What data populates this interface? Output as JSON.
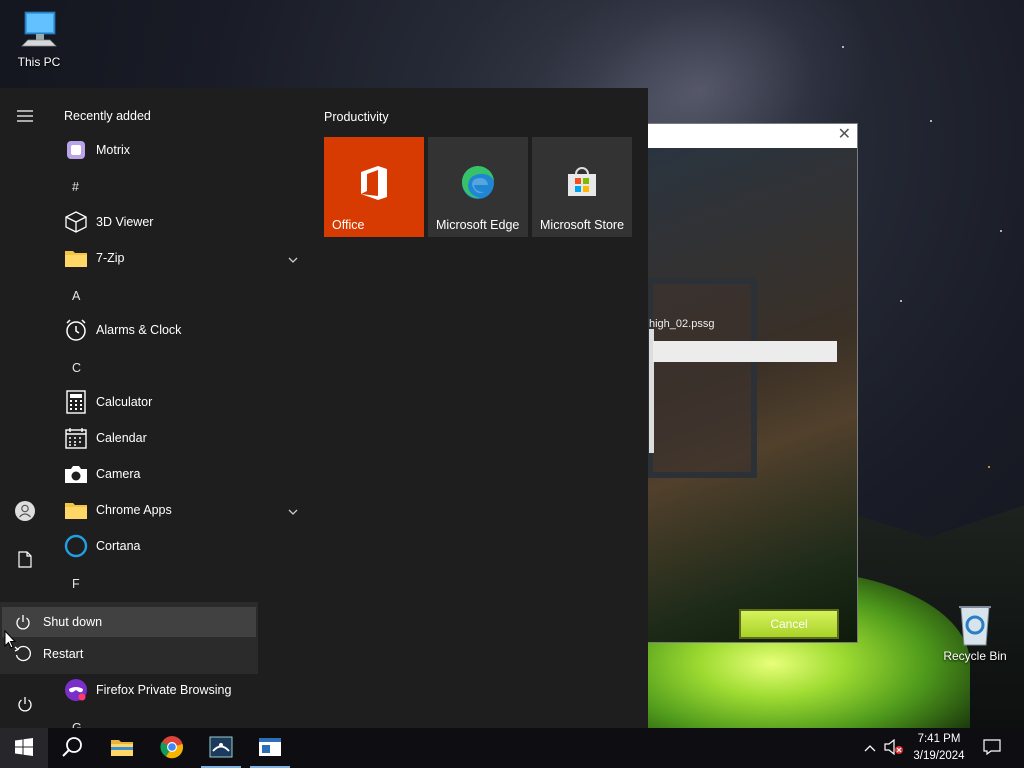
{
  "desktop": {
    "icons": [
      {
        "label": "This PC",
        "icon": "computer-icon"
      },
      {
        "label": "Recycle Bin",
        "icon": "recycle-bin-icon"
      }
    ]
  },
  "dialog": {
    "filename": "high_02.pssg",
    "cancel_label": "Cancel",
    "close_glyph": "✕",
    "progress": 0
  },
  "start_menu": {
    "recently_added_title": "Recently added",
    "apps": [
      {
        "label": "Motrix",
        "icon": "motrix-icon"
      },
      {
        "letter": "#"
      },
      {
        "label": "3D Viewer",
        "icon": "cube-icon"
      },
      {
        "label": "7-Zip",
        "icon": "folder-icon",
        "expandable": true
      },
      {
        "letter": "A"
      },
      {
        "label": "Alarms & Clock",
        "icon": "alarm-clock-icon"
      },
      {
        "letter": "C"
      },
      {
        "label": "Calculator",
        "icon": "calculator-icon"
      },
      {
        "label": "Calendar",
        "icon": "calendar-icon"
      },
      {
        "label": "Camera",
        "icon": "camera-icon"
      },
      {
        "label": "Chrome Apps",
        "icon": "folder-icon",
        "expandable": true
      },
      {
        "label": "Cortana",
        "icon": "cortana-icon"
      },
      {
        "letter": "F"
      },
      {
        "label": "Firefox Private Browsing",
        "icon": "firefox-private-icon"
      },
      {
        "letter": "G"
      }
    ],
    "power_menu": {
      "items": [
        {
          "label": "Shut down",
          "icon": "power-icon"
        },
        {
          "label": "Restart",
          "icon": "restart-icon"
        }
      ]
    },
    "tiles_group": {
      "title": "Productivity",
      "tiles": [
        {
          "label": "Office",
          "icon": "office-icon",
          "color": "#d83b01"
        },
        {
          "label": "Microsoft Edge",
          "icon": "edge-icon",
          "color": "#333333"
        },
        {
          "label": "Microsoft Store",
          "icon": "store-icon",
          "color": "#333333"
        }
      ]
    }
  },
  "taskbar": {
    "apps": [
      {
        "name": "file-explorer",
        "icon": "folder-icon"
      },
      {
        "name": "chrome",
        "icon": "chrome-icon"
      },
      {
        "name": "game-app",
        "icon": "game-app-icon"
      },
      {
        "name": "installer",
        "icon": "installer-icon"
      }
    ],
    "clock": {
      "time": "7:41 PM",
      "date": "3/19/2024"
    }
  },
  "colors": {
    "start_bg": "#1e1e1e",
    "office_tile": "#d83b01",
    "accent": "#7fb2e5",
    "cancel_button": "#b5dc2f"
  }
}
